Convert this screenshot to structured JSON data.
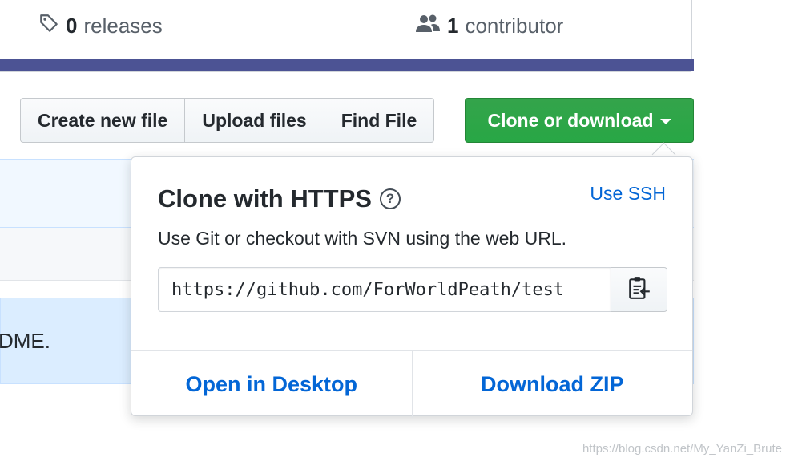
{
  "summary": {
    "releases": {
      "count": "0",
      "label": "releases",
      "icon": "tag-icon"
    },
    "contributors": {
      "count": "1",
      "label": "contributor",
      "icon": "people-icon"
    },
    "language_bar_color": "#4c5394"
  },
  "toolbar": {
    "create_new_file": "Create new file",
    "upload_files": "Upload files",
    "find_file": "Find File",
    "clone_or_download": "Clone or download"
  },
  "background": {
    "readme_fragment": "DME."
  },
  "clone_dropdown": {
    "title": "Clone with HTTPS",
    "help_icon": "question-icon",
    "use_ssh": "Use SSH",
    "description": "Use Git or checkout with SVN using the web URL.",
    "url": "https://github.com/ForWorldPeath/test",
    "copy_icon": "clipboard-icon",
    "open_in_desktop": "Open in Desktop",
    "download_zip": "Download ZIP"
  },
  "watermark": "https://blog.csdn.net/My_YanZi_Brute",
  "colors": {
    "primary_green": "#28a745",
    "link_blue": "#0366d6"
  }
}
